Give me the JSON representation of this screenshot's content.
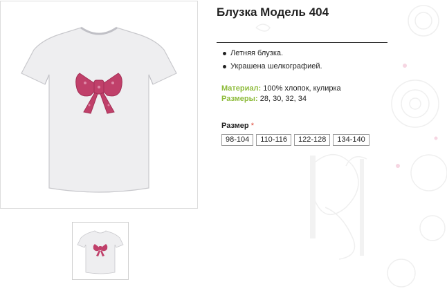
{
  "product": {
    "title": "Блузка Модель 404",
    "features": [
      "Летняя блузка.",
      "Украшена шелкографией."
    ],
    "material_label": "Материал:",
    "material_value": "100% хлопок, кулирка",
    "sizes_label": "Размеры:",
    "sizes_value": "28, 30, 32, 34",
    "size_select_label": "Размер",
    "size_required_mark": "*",
    "size_options": [
      "98-104",
      "110-116",
      "122-128",
      "134-140"
    ]
  },
  "colors": {
    "accent_green": "#8dbb3a",
    "bow_pink": "#c0406a",
    "required_red": "#dd4433"
  }
}
